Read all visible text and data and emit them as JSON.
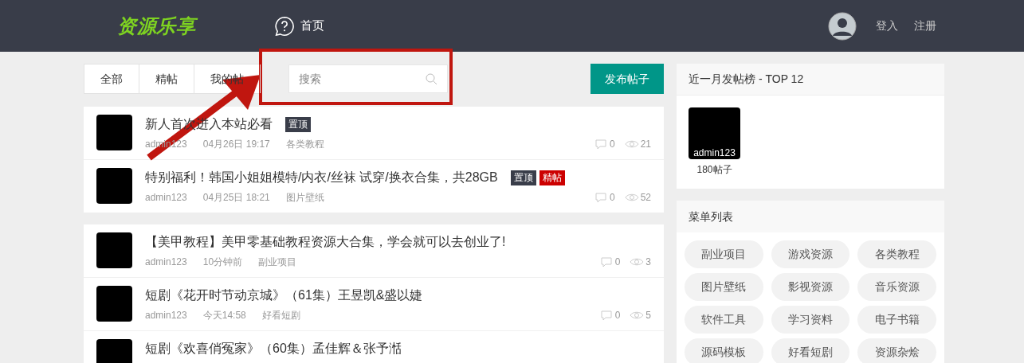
{
  "header": {
    "logo": "资源乐享",
    "nav": [
      {
        "label": "首页",
        "selected": true
      }
    ],
    "login": "登入",
    "register": "注册"
  },
  "filter_tabs": [
    {
      "label": "全部",
      "selected": false
    },
    {
      "label": "精帖",
      "selected": false
    },
    {
      "label": "我的帖",
      "selected": false
    }
  ],
  "search": {
    "placeholder": "搜索"
  },
  "post_button": "发布帖子",
  "pinned_posts": [
    {
      "title": "新人首次进入本站必看",
      "badges": [
        {
          "label": "置顶",
          "kind": "top"
        }
      ],
      "author": "admin123",
      "time": "04月26日 19:17",
      "category": "各类教程",
      "comments": "0",
      "views": "21"
    },
    {
      "title": "特别福利！韩国小姐姐模特/内衣/丝袜 试穿/换衣合集，共28GB",
      "badges": [
        {
          "label": "置顶",
          "kind": "top"
        },
        {
          "label": "精帖",
          "kind": "featured"
        }
      ],
      "author": "admin123",
      "time": "04月25日 18:21",
      "category": "图片壁纸",
      "comments": "0",
      "views": "52"
    }
  ],
  "posts": [
    {
      "title": "【美甲教程】美甲零基础教程资源大合集，学会就可以去创业了!",
      "author": "admin123",
      "time": "10分钟前",
      "category": "副业项目",
      "comments": "0",
      "views": "3"
    },
    {
      "title": "短剧《花开时节动京城》（61集）王昱凯&盛以婕",
      "author": "admin123",
      "time": "今天14:58",
      "category": "好看短剧",
      "comments": "0",
      "views": "5"
    },
    {
      "title": "短剧《欢喜俏冤家》（60集）孟佳辉＆张予湉"
    }
  ],
  "top_posters": {
    "title": "近一月发帖榜 - TOP 12",
    "users": [
      {
        "name": "admin123",
        "count": "180帖子"
      }
    ]
  },
  "menu": {
    "title": "菜单列表",
    "items": [
      "副业项目",
      "游戏资源",
      "各类教程",
      "图片壁纸",
      "影视资源",
      "音乐资源",
      "软件工具",
      "学习资料",
      "电子书籍",
      "源码模板",
      "好看短剧",
      "资源杂烩"
    ]
  }
}
